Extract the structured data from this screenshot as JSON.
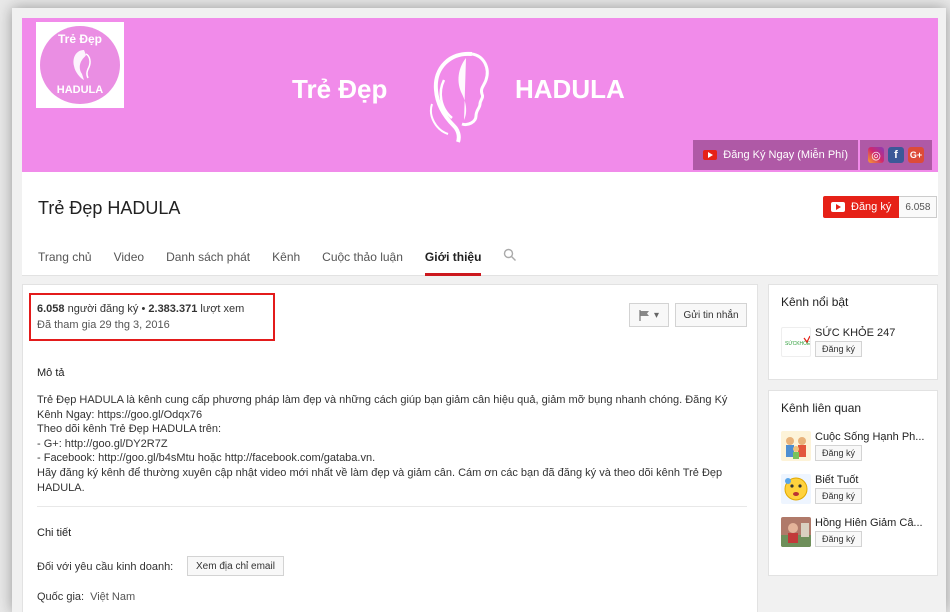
{
  "banner": {
    "title_left": "Trẻ Đẹp",
    "title_right": "HADULA",
    "avatar_top": "Trẻ Đẹp",
    "avatar_bottom": "HADULA",
    "subscribe_free_label": "Đăng Ký Ngay (Miễn Phí)",
    "social_icons": [
      "instagram-icon",
      "facebook-icon",
      "google-plus-icon"
    ],
    "social_fb": "f",
    "social_gp": "G+"
  },
  "header": {
    "channel_name": "Trẻ Đẹp HADULA",
    "subscribe_label": "Đăng ký",
    "subscriber_count": "6.058",
    "tabs": [
      {
        "label": "Trang chủ"
      },
      {
        "label": "Video"
      },
      {
        "label": "Danh sách phát"
      },
      {
        "label": "Kênh"
      },
      {
        "label": "Cuộc thảo luận"
      },
      {
        "label": "Giới thiệu"
      }
    ],
    "active_tab_color": "#cc181e"
  },
  "about": {
    "subs_count": "6.058",
    "subs_text": " người đăng ký • ",
    "views_count": "2.383.371",
    "views_text": " lượt xem",
    "joined": "Đã tham gia 29 thg 3, 2016",
    "message_button": "Gửi tin nhắn",
    "description_label": "Mô tả",
    "description_lines": [
      "Trẻ Đẹp HADULA là kênh cung cấp phương pháp làm đẹp và những cách giúp bạn giảm cân hiệu quả, giảm mỡ bụng nhanh chóng. Đăng Ký",
      "Kênh Ngay: https://goo.gl/Odqx76",
      "Theo dõi kênh Trẻ Đẹp HADULA trên:",
      "- G+: http://goo.gl/DY2R7Z",
      "- Facebook: http://goo.gl/b4sMtu hoặc http://facebook.com/gataba.vn.",
      "Hãy đăng ký kênh để thường xuyên cập nhật video mới nhất về làm đẹp và giảm cân. Cám ơn các bạn đã đăng ký và theo dõi kênh Trẻ Đẹp",
      "HADULA."
    ],
    "details_label": "Chi tiết",
    "business_label": "Đối với yêu cầu kinh doanh:",
    "email_button": "Xem địa chỉ email",
    "country_label": "Quốc gia:",
    "country_value": "Việt Nam"
  },
  "featured": {
    "title": "Kênh nổi bật",
    "items": [
      {
        "name": "SỨC KHỎE 247",
        "subscribe": "Đăng ký"
      }
    ]
  },
  "related": {
    "title": "Kênh liên quan",
    "items": [
      {
        "name": "Cuộc Sống Hạnh Ph...",
        "subscribe": "Đăng ký"
      },
      {
        "name": "Biết Tuốt",
        "subscribe": "Đăng ký"
      },
      {
        "name": "Hồng Hiên Giảm Câ...",
        "subscribe": "Đăng ký"
      }
    ]
  },
  "colors": {
    "banner": "#f18bea",
    "youtube_red": "#e62117",
    "highlight": "#e31b1b"
  }
}
